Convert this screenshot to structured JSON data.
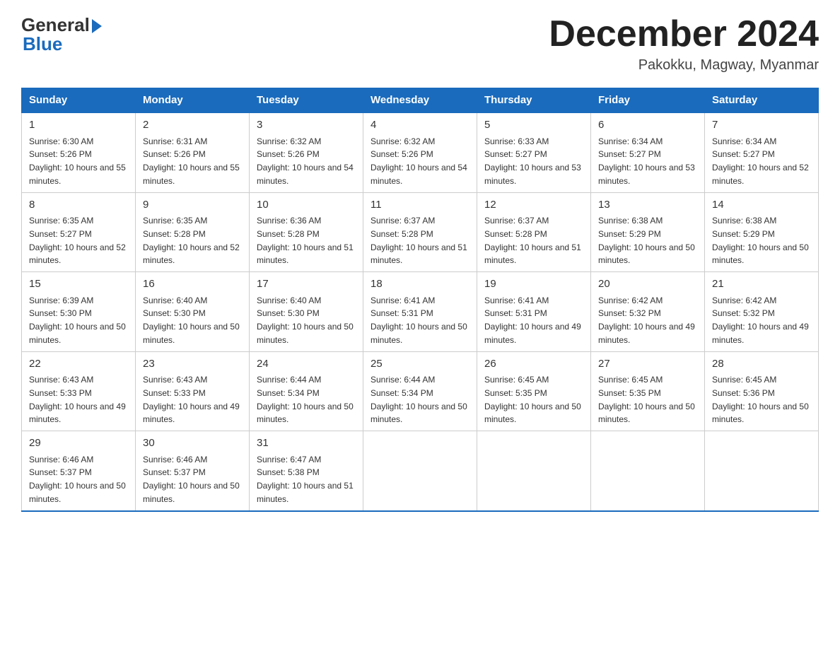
{
  "header": {
    "logo_general": "General",
    "logo_blue": "Blue",
    "month_title": "December 2024",
    "location": "Pakokku, Magway, Myanmar"
  },
  "days_of_week": [
    "Sunday",
    "Monday",
    "Tuesday",
    "Wednesday",
    "Thursday",
    "Friday",
    "Saturday"
  ],
  "weeks": [
    [
      {
        "num": "1",
        "sunrise": "6:30 AM",
        "sunset": "5:26 PM",
        "daylight": "10 hours and 55 minutes."
      },
      {
        "num": "2",
        "sunrise": "6:31 AM",
        "sunset": "5:26 PM",
        "daylight": "10 hours and 55 minutes."
      },
      {
        "num": "3",
        "sunrise": "6:32 AM",
        "sunset": "5:26 PM",
        "daylight": "10 hours and 54 minutes."
      },
      {
        "num": "4",
        "sunrise": "6:32 AM",
        "sunset": "5:26 PM",
        "daylight": "10 hours and 54 minutes."
      },
      {
        "num": "5",
        "sunrise": "6:33 AM",
        "sunset": "5:27 PM",
        "daylight": "10 hours and 53 minutes."
      },
      {
        "num": "6",
        "sunrise": "6:34 AM",
        "sunset": "5:27 PM",
        "daylight": "10 hours and 53 minutes."
      },
      {
        "num": "7",
        "sunrise": "6:34 AM",
        "sunset": "5:27 PM",
        "daylight": "10 hours and 52 minutes."
      }
    ],
    [
      {
        "num": "8",
        "sunrise": "6:35 AM",
        "sunset": "5:27 PM",
        "daylight": "10 hours and 52 minutes."
      },
      {
        "num": "9",
        "sunrise": "6:35 AM",
        "sunset": "5:28 PM",
        "daylight": "10 hours and 52 minutes."
      },
      {
        "num": "10",
        "sunrise": "6:36 AM",
        "sunset": "5:28 PM",
        "daylight": "10 hours and 51 minutes."
      },
      {
        "num": "11",
        "sunrise": "6:37 AM",
        "sunset": "5:28 PM",
        "daylight": "10 hours and 51 minutes."
      },
      {
        "num": "12",
        "sunrise": "6:37 AM",
        "sunset": "5:28 PM",
        "daylight": "10 hours and 51 minutes."
      },
      {
        "num": "13",
        "sunrise": "6:38 AM",
        "sunset": "5:29 PM",
        "daylight": "10 hours and 50 minutes."
      },
      {
        "num": "14",
        "sunrise": "6:38 AM",
        "sunset": "5:29 PM",
        "daylight": "10 hours and 50 minutes."
      }
    ],
    [
      {
        "num": "15",
        "sunrise": "6:39 AM",
        "sunset": "5:30 PM",
        "daylight": "10 hours and 50 minutes."
      },
      {
        "num": "16",
        "sunrise": "6:40 AM",
        "sunset": "5:30 PM",
        "daylight": "10 hours and 50 minutes."
      },
      {
        "num": "17",
        "sunrise": "6:40 AM",
        "sunset": "5:30 PM",
        "daylight": "10 hours and 50 minutes."
      },
      {
        "num": "18",
        "sunrise": "6:41 AM",
        "sunset": "5:31 PM",
        "daylight": "10 hours and 50 minutes."
      },
      {
        "num": "19",
        "sunrise": "6:41 AM",
        "sunset": "5:31 PM",
        "daylight": "10 hours and 49 minutes."
      },
      {
        "num": "20",
        "sunrise": "6:42 AM",
        "sunset": "5:32 PM",
        "daylight": "10 hours and 49 minutes."
      },
      {
        "num": "21",
        "sunrise": "6:42 AM",
        "sunset": "5:32 PM",
        "daylight": "10 hours and 49 minutes."
      }
    ],
    [
      {
        "num": "22",
        "sunrise": "6:43 AM",
        "sunset": "5:33 PM",
        "daylight": "10 hours and 49 minutes."
      },
      {
        "num": "23",
        "sunrise": "6:43 AM",
        "sunset": "5:33 PM",
        "daylight": "10 hours and 49 minutes."
      },
      {
        "num": "24",
        "sunrise": "6:44 AM",
        "sunset": "5:34 PM",
        "daylight": "10 hours and 50 minutes."
      },
      {
        "num": "25",
        "sunrise": "6:44 AM",
        "sunset": "5:34 PM",
        "daylight": "10 hours and 50 minutes."
      },
      {
        "num": "26",
        "sunrise": "6:45 AM",
        "sunset": "5:35 PM",
        "daylight": "10 hours and 50 minutes."
      },
      {
        "num": "27",
        "sunrise": "6:45 AM",
        "sunset": "5:35 PM",
        "daylight": "10 hours and 50 minutes."
      },
      {
        "num": "28",
        "sunrise": "6:45 AM",
        "sunset": "5:36 PM",
        "daylight": "10 hours and 50 minutes."
      }
    ],
    [
      {
        "num": "29",
        "sunrise": "6:46 AM",
        "sunset": "5:37 PM",
        "daylight": "10 hours and 50 minutes."
      },
      {
        "num": "30",
        "sunrise": "6:46 AM",
        "sunset": "5:37 PM",
        "daylight": "10 hours and 50 minutes."
      },
      {
        "num": "31",
        "sunrise": "6:47 AM",
        "sunset": "5:38 PM",
        "daylight": "10 hours and 51 minutes."
      },
      null,
      null,
      null,
      null
    ]
  ]
}
